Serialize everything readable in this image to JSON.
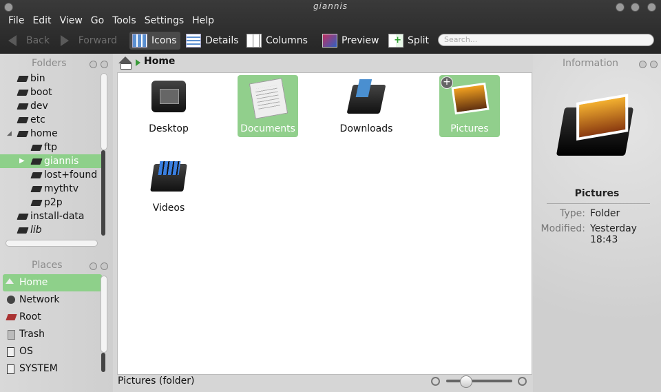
{
  "window": {
    "title": "giannis"
  },
  "menubar": [
    "File",
    "Edit",
    "View",
    "Go",
    "Tools",
    "Settings",
    "Help"
  ],
  "toolbar": {
    "back": "Back",
    "forward": "Forward",
    "icons": "Icons",
    "details": "Details",
    "columns": "Columns",
    "preview": "Preview",
    "split": "Split",
    "search_placeholder": "Search..."
  },
  "folders_panel": {
    "title": "Folders",
    "items": [
      {
        "label": "bin",
        "depth": 0
      },
      {
        "label": "boot",
        "depth": 0
      },
      {
        "label": "dev",
        "depth": 0
      },
      {
        "label": "etc",
        "depth": 0
      },
      {
        "label": "home",
        "depth": 0
      },
      {
        "label": "ftp",
        "depth": 1
      },
      {
        "label": "giannis",
        "depth": 1
      },
      {
        "label": "lost+found",
        "depth": 1
      },
      {
        "label": "mythtv",
        "depth": 1
      },
      {
        "label": "p2p",
        "depth": 1
      },
      {
        "label": "install-data",
        "depth": 0
      },
      {
        "label": "lib",
        "depth": 0
      }
    ]
  },
  "places_panel": {
    "title": "Places",
    "items": [
      "Home",
      "Network",
      "Root",
      "Trash",
      "OS",
      "SYSTEM"
    ]
  },
  "location": {
    "crumb": "Home"
  },
  "files": [
    "Desktop",
    "Documents",
    "Downloads",
    "Pictures",
    "Videos"
  ],
  "status": {
    "text": "Pictures (folder)"
  },
  "information": {
    "title": "Information",
    "name": "Pictures",
    "type_label": "Type:",
    "type_value": "Folder",
    "modified_label": "Modified:",
    "modified_value_1": "Yesterday",
    "modified_value_2": "18:43"
  },
  "colors": {
    "selection": "#8ed08a",
    "toolbar": "#2e2e2e"
  }
}
